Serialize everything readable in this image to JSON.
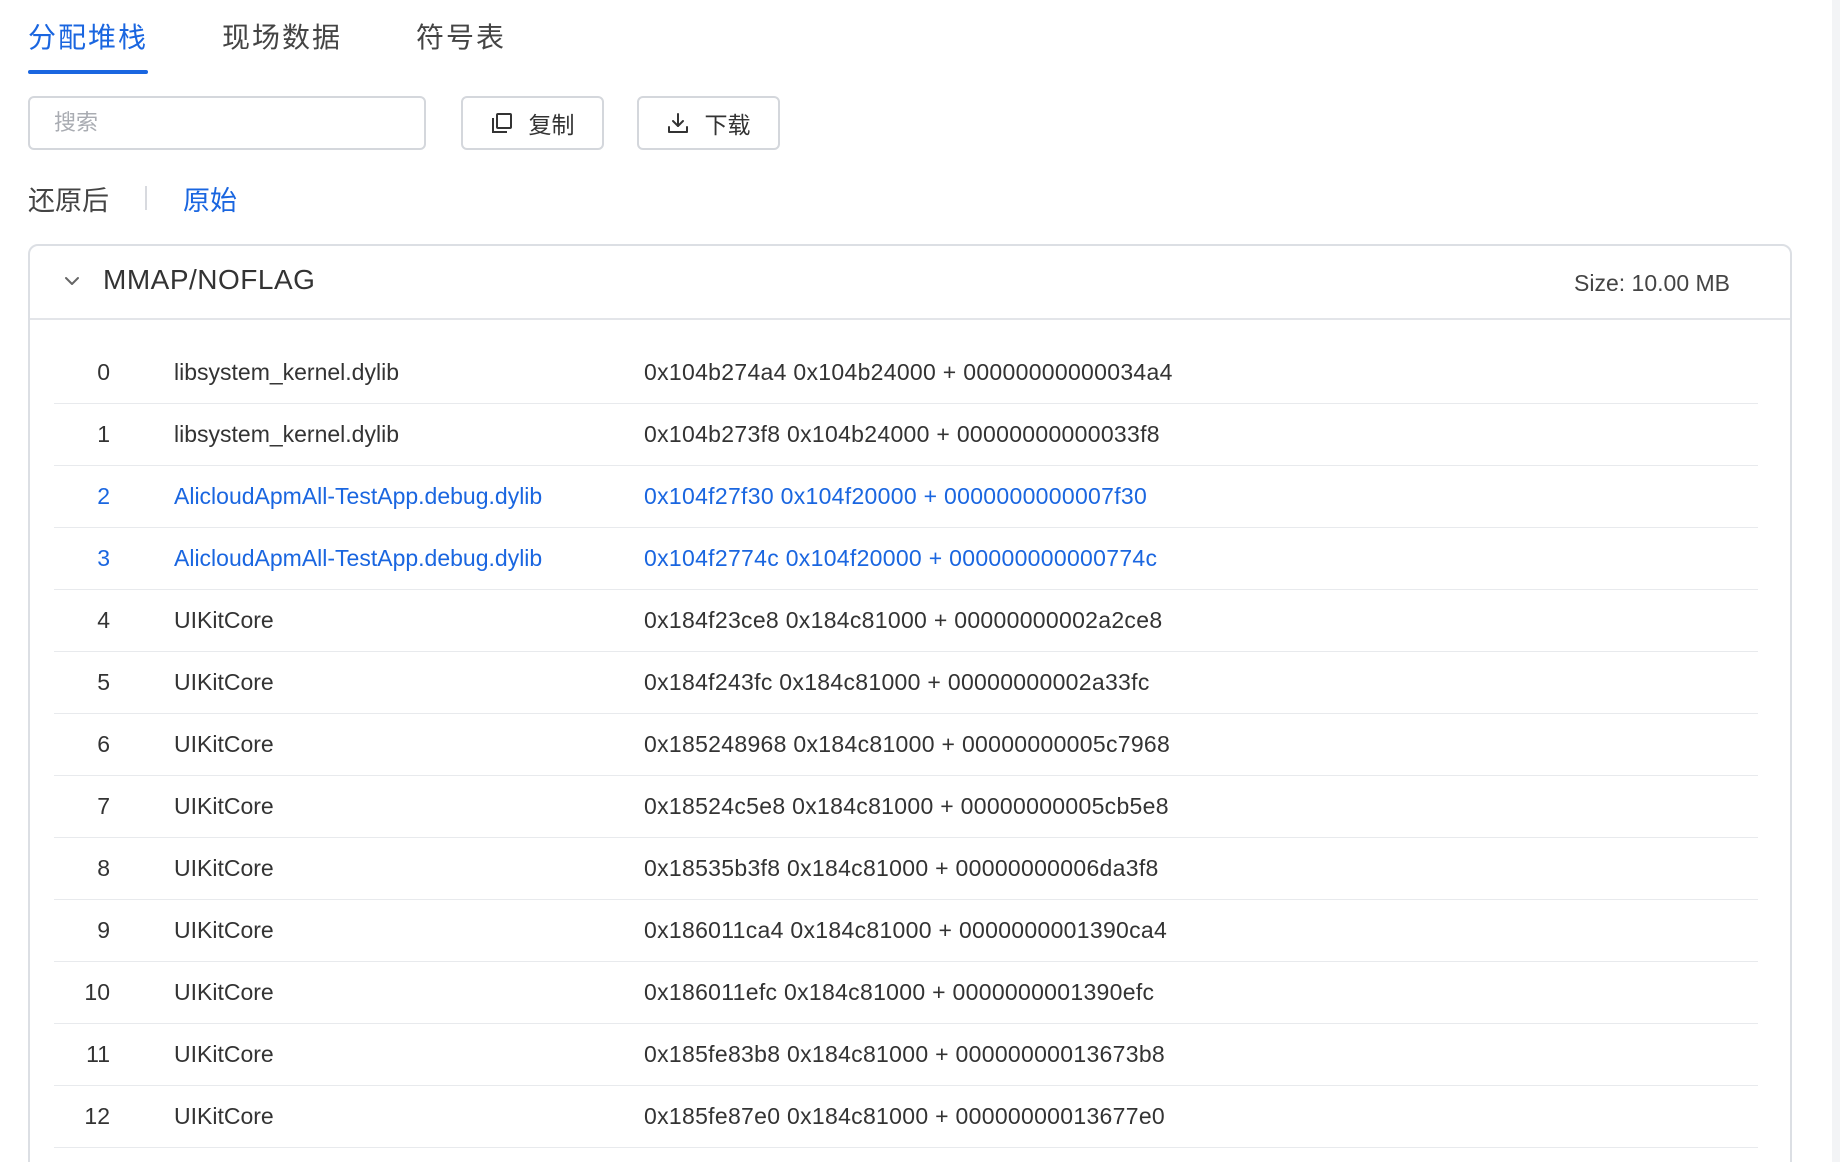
{
  "tabs": [
    {
      "label": "分配堆栈",
      "active": true
    },
    {
      "label": "现场数据",
      "active": false
    },
    {
      "label": "符号表",
      "active": false
    }
  ],
  "toolbar": {
    "search_placeholder": "搜索",
    "copy_label": "复制",
    "download_label": "下载"
  },
  "view_toggle": {
    "restored_label": "还原后",
    "original_label": "原始",
    "active": "original"
  },
  "panel": {
    "title": "MMAP/NOFLAG",
    "size_text": "Size: 10.00 MB",
    "expanded": true
  },
  "colors": {
    "accent": "#1a66e0",
    "text": "#333333",
    "border": "#dcdfe4"
  },
  "frames": [
    {
      "index": "0",
      "library": "libsystem_kernel.dylib",
      "address": "0x104b274a4 0x104b24000 + 00000000000034a4",
      "highlight": false
    },
    {
      "index": "1",
      "library": "libsystem_kernel.dylib",
      "address": "0x104b273f8 0x104b24000 + 00000000000033f8",
      "highlight": false
    },
    {
      "index": "2",
      "library": "AlicloudApmAll-TestApp.debug.dylib",
      "address": "0x104f27f30 0x104f20000 + 0000000000007f30",
      "highlight": true
    },
    {
      "index": "3",
      "library": "AlicloudApmAll-TestApp.debug.dylib",
      "address": "0x104f2774c 0x104f20000 + 000000000000774c",
      "highlight": true
    },
    {
      "index": "4",
      "library": "UIKitCore",
      "address": "0x184f23ce8 0x184c81000 + 00000000002a2ce8",
      "highlight": false
    },
    {
      "index": "5",
      "library": "UIKitCore",
      "address": "0x184f243fc 0x184c81000 + 00000000002a33fc",
      "highlight": false
    },
    {
      "index": "6",
      "library": "UIKitCore",
      "address": "0x185248968 0x184c81000 + 00000000005c7968",
      "highlight": false
    },
    {
      "index": "7",
      "library": "UIKitCore",
      "address": "0x18524c5e8 0x184c81000 + 00000000005cb5e8",
      "highlight": false
    },
    {
      "index": "8",
      "library": "UIKitCore",
      "address": "0x18535b3f8 0x184c81000 + 00000000006da3f8",
      "highlight": false
    },
    {
      "index": "9",
      "library": "UIKitCore",
      "address": "0x186011ca4 0x184c81000 + 0000000001390ca4",
      "highlight": false
    },
    {
      "index": "10",
      "library": "UIKitCore",
      "address": "0x186011efc 0x184c81000 + 0000000001390efc",
      "highlight": false
    },
    {
      "index": "11",
      "library": "UIKitCore",
      "address": "0x185fe83b8 0x184c81000 + 00000000013673b8",
      "highlight": false
    },
    {
      "index": "12",
      "library": "UIKitCore",
      "address": "0x185fe87e0 0x184c81000 + 00000000013677e0",
      "highlight": false
    }
  ]
}
